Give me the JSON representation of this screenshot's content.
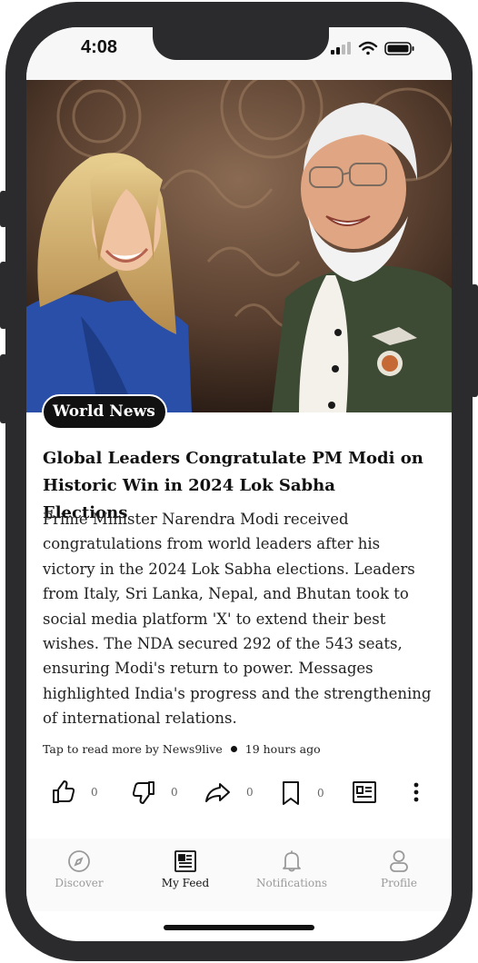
{
  "status_bar": {
    "time": "4:08"
  },
  "article": {
    "category": "World News",
    "headline": "Global Leaders Congratulate PM Modi on Historic Win in 2024 Lok Sabha Elections",
    "summary": "Prime Minister Narendra Modi received congratulations from world leaders after his victory in the 2024 Lok Sabha elections. Leaders from Italy, Sri Lanka, Nepal, and Bhutan took to social media platform 'X' to extend their best wishes. The NDA secured 292 of the 543 seats, ensuring Modi's return to power. Messages highlighted India's progress and the strengthening of international relations.",
    "source_text": "Tap to read more by News9live",
    "time_ago": "19 hours ago"
  },
  "actions": {
    "like": {
      "icon": "thumbs-up-icon",
      "count": "0"
    },
    "dislike": {
      "icon": "thumbs-down-icon",
      "count": "0"
    },
    "share": {
      "icon": "share-icon",
      "count": "0"
    },
    "bookmark": {
      "icon": "bookmark-icon",
      "count": "0"
    },
    "reader": {
      "icon": "reader-icon"
    },
    "more": {
      "icon": "more-vertical-icon"
    }
  },
  "bottom_nav": [
    {
      "label": "Discover",
      "icon": "compass-icon",
      "active": false
    },
    {
      "label": "My Feed",
      "icon": "newspaper-icon",
      "active": true
    },
    {
      "label": "Notifications",
      "icon": "bell-icon",
      "active": false
    },
    {
      "label": "Profile",
      "icon": "person-icon",
      "active": false
    }
  ],
  "colors": {
    "frame": "#2b2b2d",
    "text": "#111111",
    "inactive": "#9a9a9a",
    "pill": "#111111"
  }
}
